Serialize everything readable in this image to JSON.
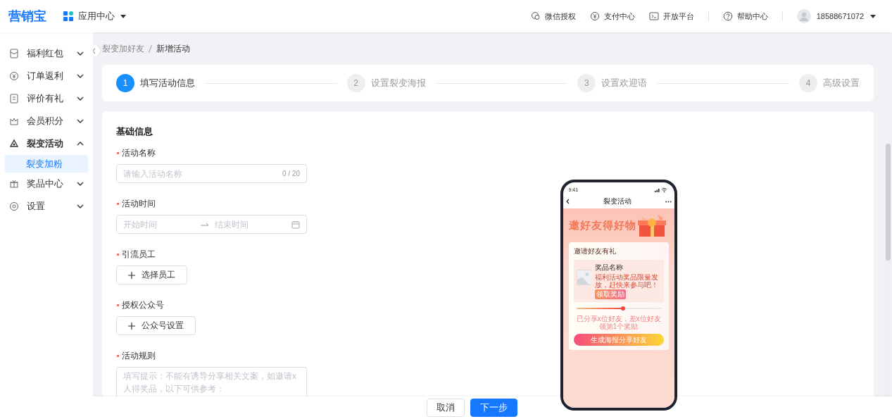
{
  "header": {
    "logo": "营销宝",
    "app_menu": "应用中心",
    "links": [
      {
        "label": "微信授权"
      },
      {
        "label": "支付中心"
      },
      {
        "label": "开放平台"
      }
    ],
    "help": "帮助中心",
    "user": "18588671072"
  },
  "sidebar": {
    "items": [
      {
        "label": "福利红包",
        "expanded": false
      },
      {
        "label": "订单返利",
        "expanded": false
      },
      {
        "label": "评价有礼",
        "expanded": false
      },
      {
        "label": "会员积分",
        "expanded": false
      },
      {
        "label": "裂变活动",
        "expanded": true,
        "children": [
          {
            "label": "裂变加粉",
            "selected": true
          }
        ]
      },
      {
        "label": "奖品中心",
        "expanded": false
      },
      {
        "label": "设置",
        "expanded": false
      }
    ]
  },
  "breadcrumb": [
    "裂变加好友",
    "新增活动"
  ],
  "steps": [
    {
      "number": "1",
      "label": "填写活动信息",
      "current": true
    },
    {
      "number": "2",
      "label": "设置裂变海报",
      "current": false
    },
    {
      "number": "3",
      "label": "设置欢迎语",
      "current": false
    },
    {
      "number": "4",
      "label": "高级设置",
      "current": false
    }
  ],
  "form": {
    "title": "基础信息",
    "fields": [
      {
        "kind": "text",
        "label": "活动名称",
        "required": true,
        "placeholder": "请输入活动名称",
        "counter": "0 / 20"
      },
      {
        "kind": "daterange",
        "label": "活动时间",
        "required": true,
        "start_placeholder": "开始时间",
        "end_placeholder": "结束时间"
      },
      {
        "kind": "button",
        "label": "引流员工",
        "required": true,
        "button": "选择员工"
      },
      {
        "kind": "button",
        "label": "授权公众号",
        "required": true,
        "button": "公众号设置"
      },
      {
        "kind": "textarea",
        "label": "活动规则",
        "required": true,
        "placeholder": "填写提示：不能有诱导分享相关文案，如邀请x人得奖品，以下可供参考："
      }
    ]
  },
  "preview": {
    "time": "9:41",
    "title": "裂变活动",
    "banner": "邀好友得好物",
    "card_title": "邀请好友有礼",
    "prize_name": "奖品名称",
    "prize_desc": "福利活动奖品限量发放，赶快来参与吧！",
    "claim": "领取奖励",
    "progress": {
      "level": 0.55
    },
    "progress_text": "已分享x位好友，差x位好友领第1个奖励",
    "share_button": "生成海报分享好友"
  },
  "footer": {
    "buttons": [
      {
        "label": "取消",
        "kind": "secondary"
      },
      {
        "label": "下一步",
        "kind": "primary"
      }
    ]
  }
}
